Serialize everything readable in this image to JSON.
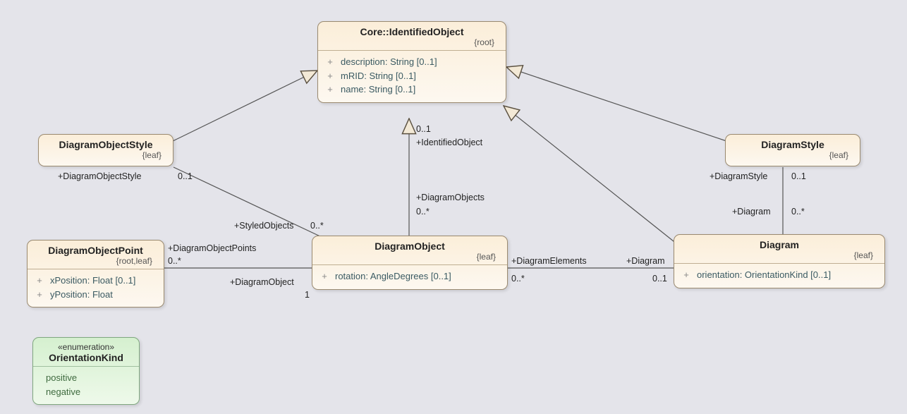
{
  "classes": {
    "identifiedObject": {
      "title": "Core::IdentifiedObject",
      "tags": "{root}",
      "attrs": [
        {
          "vis": "+",
          "text": "description: String [0..1]"
        },
        {
          "vis": "+",
          "text": "mRID: String [0..1]"
        },
        {
          "vis": "+",
          "text": "name: String [0..1]"
        }
      ]
    },
    "diagramObjectStyle": {
      "title": "DiagramObjectStyle",
      "tags": "{leaf}"
    },
    "diagramStyle": {
      "title": "DiagramStyle",
      "tags": "{leaf}"
    },
    "diagramObjectPoint": {
      "title": "DiagramObjectPoint",
      "tags": "{root,leaf}",
      "attrs": [
        {
          "vis": "+",
          "text": "xPosition: Float [0..1]"
        },
        {
          "vis": "+",
          "text": "yPosition: Float"
        }
      ]
    },
    "diagramObject": {
      "title": "DiagramObject",
      "tags": "{leaf}",
      "attrs": [
        {
          "vis": "+",
          "text": "rotation: AngleDegrees [0..1]"
        }
      ]
    },
    "diagram": {
      "title": "Diagram",
      "tags": "{leaf}",
      "attrs": [
        {
          "vis": "+",
          "text": "orientation: OrientationKind [0..1]"
        }
      ]
    }
  },
  "enums": {
    "orientationKind": {
      "stereo": "«enumeration»",
      "title": "OrientationKind",
      "literals": [
        "positive",
        "negative"
      ]
    }
  },
  "labels": {
    "gen_idObj_mult": "0..1",
    "gen_idObj_role": "+IdentifiedObject",
    "do_idObj_role": "+DiagramObjects",
    "do_idObj_mult": "0..*",
    "dos_role": "+DiagramObjectStyle",
    "dos_mult": "0..1",
    "styled_role": "+StyledObjects",
    "styled_mult": "0..*",
    "dop_role": "+DiagramObjectPoints",
    "dop_mult": "0..*",
    "dopDo_role": "+DiagramObject",
    "dopDo_mult": "1",
    "de_role": "+DiagramElements",
    "de_mult": "0..*",
    "diag_role": "+Diagram",
    "diag_mult": "0..1",
    "ds_role": "+DiagramStyle",
    "ds_mult": "0..1",
    "dsDiag_role": "+Diagram",
    "dsDiag_mult": "0..*"
  }
}
